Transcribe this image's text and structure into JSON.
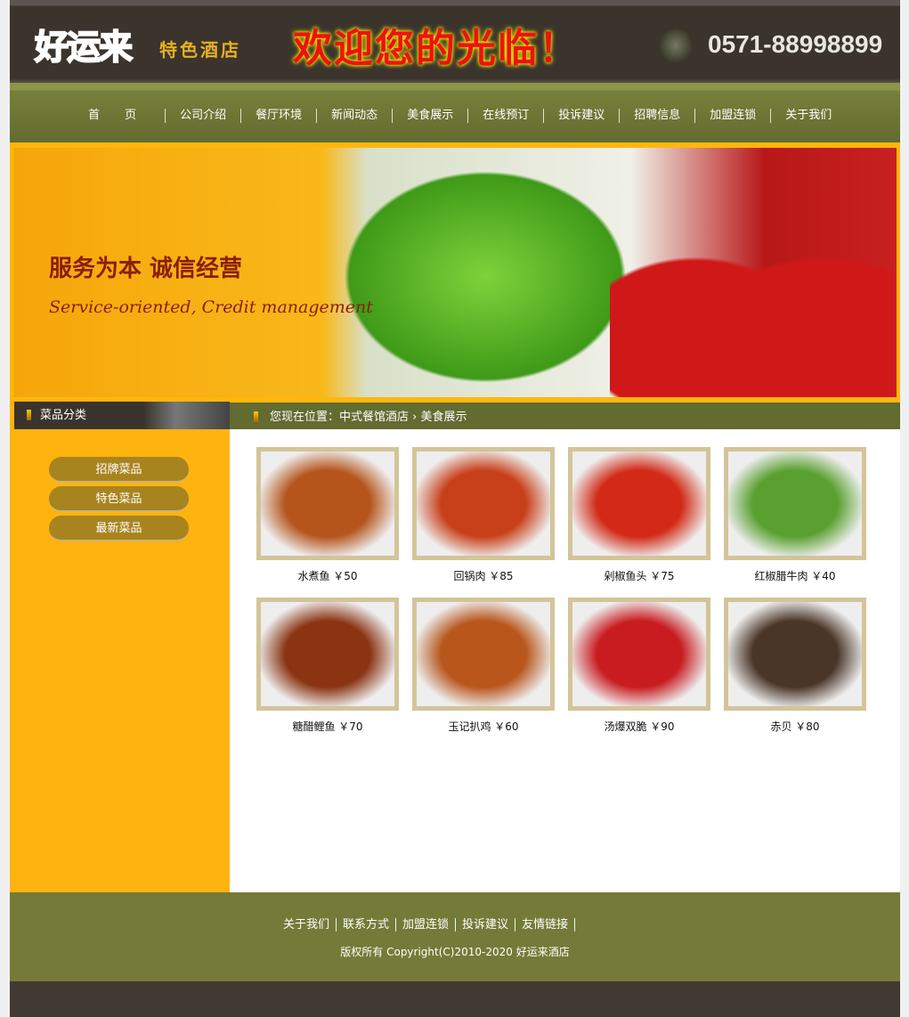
{
  "header": {
    "logo": "好运来",
    "logo_sub": "特色酒店",
    "welcome": "欢迎您的光临！",
    "phone": "0571-88998899"
  },
  "nav": [
    "首 页",
    "公司介绍",
    "餐厅环境",
    "新闻动态",
    "美食展示",
    "在线预订",
    "投诉建议",
    "招聘信息",
    "加盟连锁",
    "关于我们"
  ],
  "banner": {
    "slogan": "服务为本 诚信经营",
    "slogan_en": "Service-oriented, Credit management"
  },
  "sidebar": {
    "title": "菜品分类",
    "items": [
      "招牌菜品",
      "特色菜品",
      "最新菜品"
    ]
  },
  "breadcrumb": {
    "text": "您现在位置：中式餐馆酒店 › 美食展示"
  },
  "dishes": [
    {
      "name": "水煮鱼 ￥50",
      "color": "#b5551c"
    },
    {
      "name": "回锅肉 ￥85",
      "color": "#c8401a"
    },
    {
      "name": "剁椒鱼头 ￥75",
      "color": "#d22a16"
    },
    {
      "name": "红椒腊牛肉 ￥40",
      "color": "#5aa030"
    },
    {
      "name": "糖醋鲤鱼 ￥70",
      "color": "#8a3412"
    },
    {
      "name": "玉记扒鸡 ￥60",
      "color": "#b8561c"
    },
    {
      "name": "汤爆双脆 ￥90",
      "color": "#c81c20"
    },
    {
      "name": "赤贝 ￥80",
      "color": "#4a3628"
    }
  ],
  "footer": {
    "links": [
      "关于我们",
      "联系方式",
      "加盟连锁",
      "投诉建议",
      "友情链接"
    ],
    "copyright": "版权所有 Copyright(C)2010-2020 好运来酒店"
  }
}
